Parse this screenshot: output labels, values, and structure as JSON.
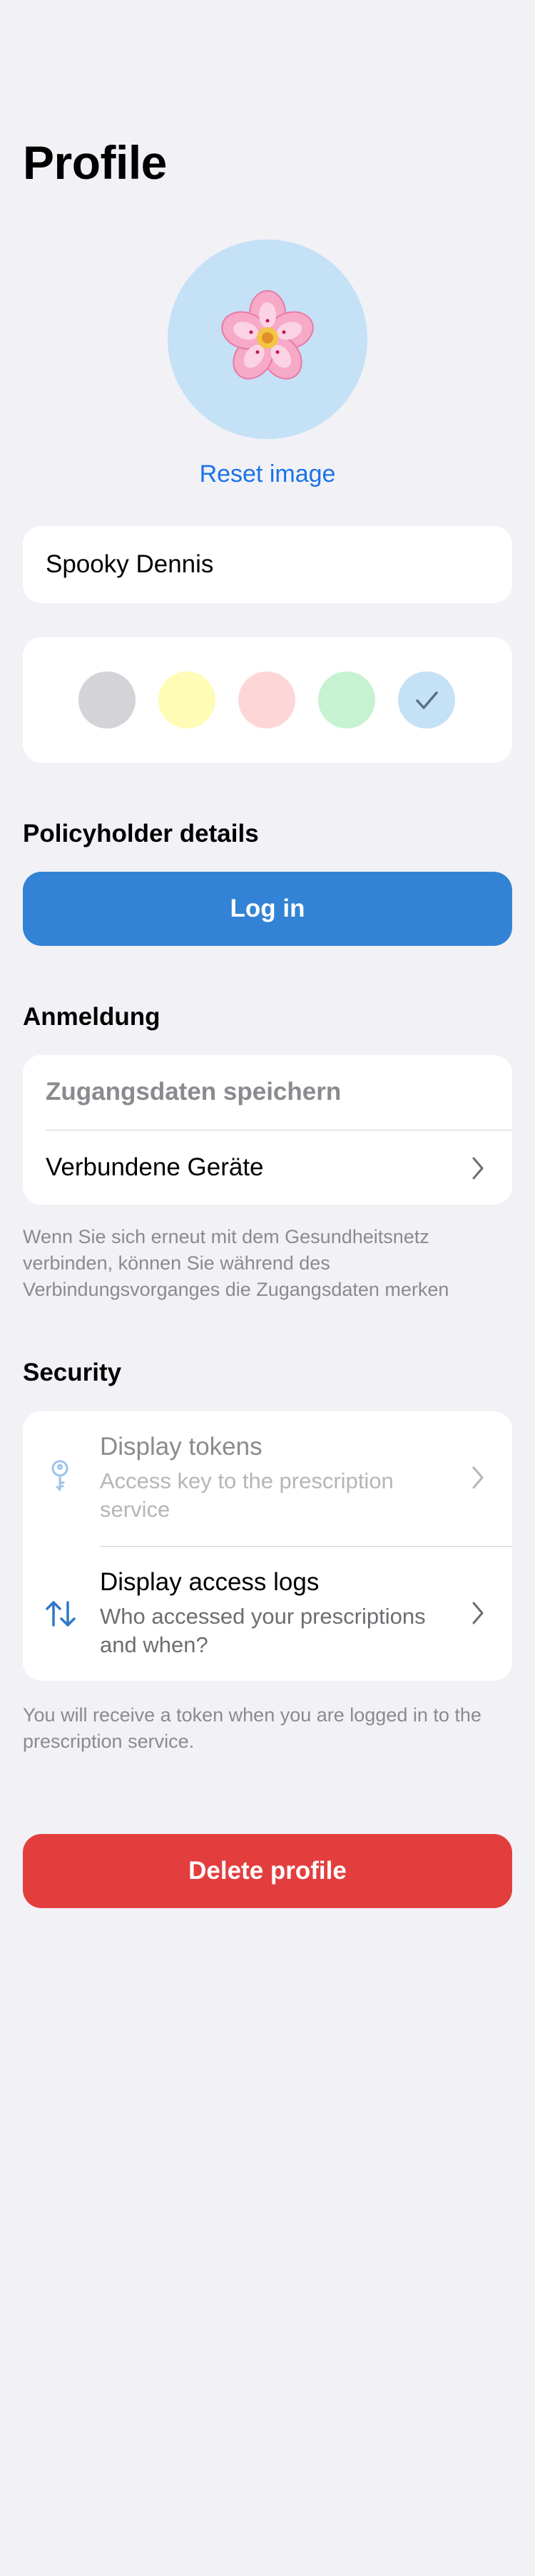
{
  "page": {
    "title": "Profile"
  },
  "avatar": {
    "icon": "cherry-blossom-emoji",
    "background": "#c4e1f6",
    "reset_label": "Reset image"
  },
  "name_field": {
    "value": "Spooky Dennis"
  },
  "colors": {
    "options": [
      {
        "name": "grey",
        "hex": "#d3d3d8"
      },
      {
        "name": "yellow",
        "hex": "#fefcb6"
      },
      {
        "name": "red",
        "hex": "#fdd7d7"
      },
      {
        "name": "green",
        "hex": "#c6f2d1"
      },
      {
        "name": "blue",
        "hex": "#c4e1f6"
      }
    ],
    "selected": "blue"
  },
  "policyholder": {
    "header": "Policyholder details",
    "login_label": "Log in",
    "accent": "#3283d5"
  },
  "registration": {
    "header": "Anmeldung",
    "save_credentials": "Zugangsdaten speichern",
    "connected_devices": "Verbundene Geräte",
    "footnote": "Wenn Sie sich erneut mit dem Gesundheitsnetz verbinden, können Sie während des Verbindungsvorganges die Zugangsdaten merken"
  },
  "security": {
    "header": "Security",
    "tokens": {
      "title": "Display tokens",
      "subtitle": "Access key to the prescription service",
      "enabled": false
    },
    "access_logs": {
      "title": "Display access logs",
      "subtitle": "Who accessed your prescriptions and when?",
      "enabled": true
    },
    "footnote": "You will receive a token when you are logged in to the prescription service."
  },
  "delete": {
    "label": "Delete profile",
    "color": "#e33e3e"
  }
}
